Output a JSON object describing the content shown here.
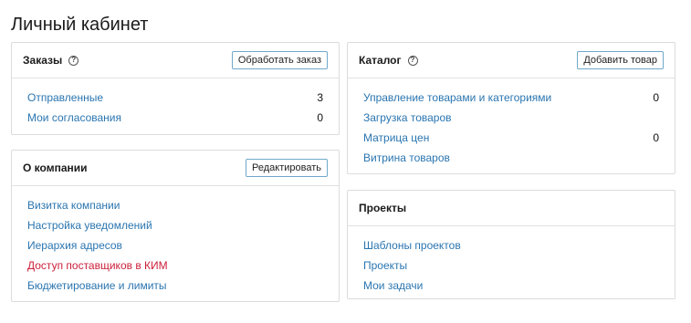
{
  "page": {
    "title": "Личный кабинет"
  },
  "orders": {
    "title": "Заказы",
    "button": "Обработать заказ",
    "items": [
      {
        "label": "Отправленные",
        "count": "3"
      },
      {
        "label": "Мои согласования",
        "count": "0"
      }
    ]
  },
  "catalog": {
    "title": "Каталог",
    "button": "Добавить товар",
    "items": [
      {
        "label": "Управление товарами и категориями",
        "count": "0"
      },
      {
        "label": "Загрузка товаров",
        "count": ""
      },
      {
        "label": "Матрица цен",
        "count": "0"
      },
      {
        "label": "Витрина товаров",
        "count": ""
      }
    ]
  },
  "company": {
    "title": "О компании",
    "button": "Редактировать",
    "items": [
      {
        "label": "Визитка компании"
      },
      {
        "label": "Настройка уведомлений"
      },
      {
        "label": "Иерархия адресов"
      },
      {
        "label": "Доступ поставщиков в КИМ"
      },
      {
        "label": "Бюджетирование и лимиты"
      }
    ]
  },
  "projects": {
    "title": "Проекты",
    "items": [
      {
        "label": "Шаблоны проектов"
      },
      {
        "label": "Проекты"
      },
      {
        "label": "Мои задачи"
      }
    ]
  },
  "colors": {
    "link": "#2a75b0",
    "alert_link": "#cc1f3a",
    "button_border": "#6fa8c9"
  },
  "icons": {
    "help": "question-circle-icon"
  }
}
